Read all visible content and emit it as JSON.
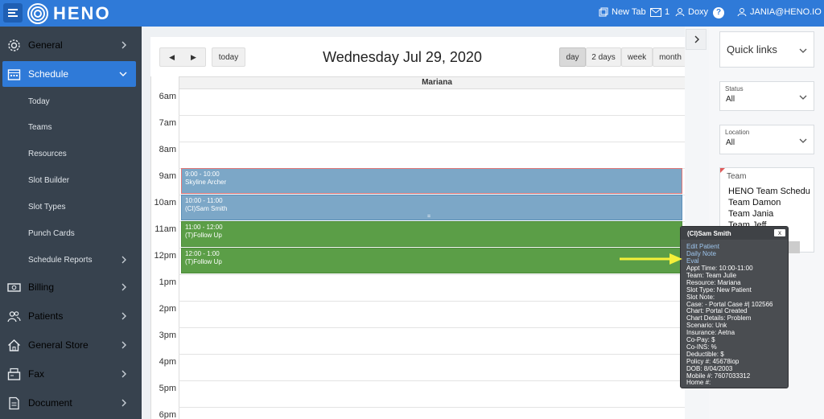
{
  "topbar": {
    "brand": "HENO",
    "new_tab": "New Tab",
    "mail_count": "1",
    "doxy": "Doxy",
    "help": "?",
    "user": "JANIA@HENO.IO"
  },
  "sidebar": {
    "items": [
      {
        "label": "General",
        "icon": "gear-icon"
      },
      {
        "label": "Schedule",
        "icon": "calendar-icon"
      },
      {
        "label": "Billing",
        "icon": "money-icon"
      },
      {
        "label": "Patients",
        "icon": "users-icon"
      },
      {
        "label": "General Store",
        "icon": "home-icon"
      },
      {
        "label": "Fax",
        "icon": "fax-icon"
      },
      {
        "label": "Document",
        "icon": "document-icon"
      }
    ],
    "schedule_sub": [
      "Today",
      "Teams",
      "Resources",
      "Slot Builder",
      "Slot Types",
      "Punch Cards",
      "Schedule Reports"
    ]
  },
  "calendar": {
    "today": "today",
    "views": [
      "day",
      "2 days",
      "week",
      "month"
    ],
    "title": "Wednesday Jul 29, 2020",
    "column": "Mariana",
    "hours": [
      "6am",
      "7am",
      "8am",
      "9am",
      "10am",
      "11am",
      "12pm",
      "1pm",
      "2pm",
      "3pm",
      "4pm",
      "5pm",
      "6pm"
    ],
    "events": [
      {
        "time": "9:00 - 10:00",
        "title": "Skyline Archer"
      },
      {
        "time": "10:00 - 11:00",
        "title": "(CI)Sam Smith"
      },
      {
        "time": "11:00 - 12:00",
        "title": "(T)Follow Up"
      },
      {
        "time": "12:00 - 1:00",
        "title": "(T)Follow Up"
      }
    ],
    "resize_handle": "="
  },
  "right_panel": {
    "quick_links": "Quick links",
    "status_label": "Status",
    "status_value": "All",
    "location_label": "Location",
    "location_value": "All",
    "team_label": "Team",
    "team_items": [
      "HENO Team Schedu",
      "Team Damon",
      "Team Jania",
      "Team Jeff"
    ]
  },
  "popover": {
    "title": "(CI)Sam Smith",
    "close": "x",
    "links": [
      "Edit Patient",
      "Daily Note",
      "Eval"
    ],
    "lines": [
      "Appt Time: 10:00-11:00",
      "Team: Team Julie",
      "Resource: Mariana",
      "Slot Type: New Patient",
      "Slot Note:",
      "Case: - Portal Case #| 102566",
      "Chart: Portal Created",
      "Chart Details: Problem",
      "Scenario: Unk",
      "Insurance: Aetna",
      "Co-Pay: $",
      "Co-INS: %",
      "Deductible: $",
      "Policy #: 45678iop",
      "DOB: 8/04/2003",
      "Mobile #: 7607033312",
      "Home #:"
    ]
  },
  "colors": {
    "brand_blue": "#2f7ad8",
    "sidebar": "#37424e",
    "event_blue": "#7ca7c7",
    "event_green": "#5b9e47",
    "arrow": "#f4f03a"
  }
}
